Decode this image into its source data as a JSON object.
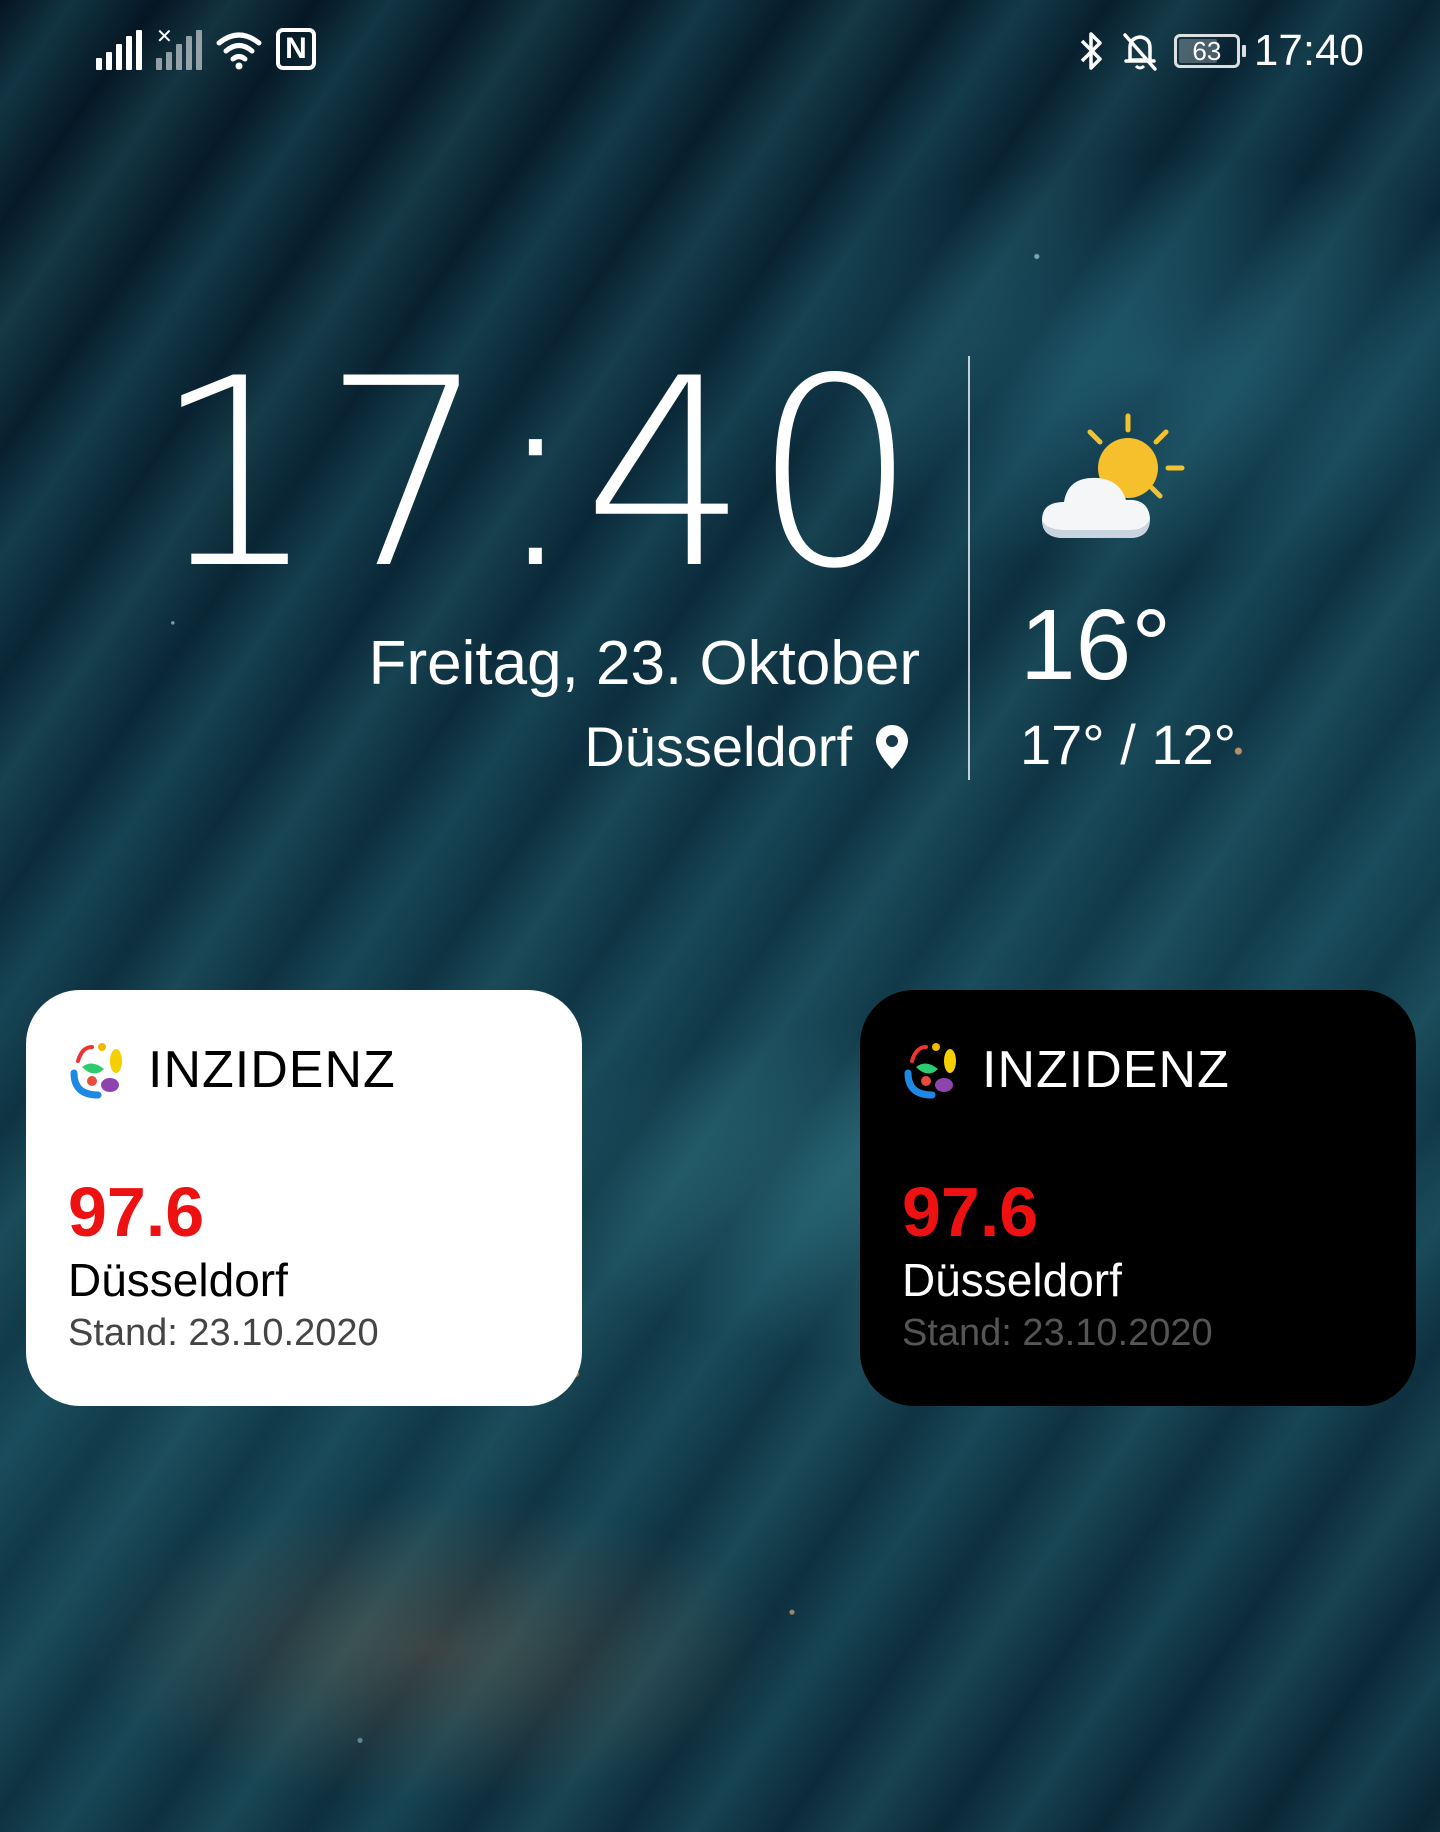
{
  "status_bar": {
    "time": "17:40",
    "battery_level": "63",
    "icons": [
      "signal-icon",
      "signal-no-sim-icon",
      "wifi-icon",
      "nfc-icon",
      "bluetooth-icon",
      "bell-off-icon",
      "battery-icon"
    ]
  },
  "lockscreen": {
    "clock": "17:40",
    "date": "Freitag, 23. Oktober",
    "location": "Düsseldorf",
    "weather": {
      "icon": "partly-cloudy-icon",
      "temperature": "16°",
      "range": "17° / 12°"
    }
  },
  "widgets": [
    {
      "theme": "light",
      "title": "INZIDENZ",
      "value": "97.6",
      "city": "Düsseldorf",
      "stand": "Stand: 23.10.2020"
    },
    {
      "theme": "dark",
      "title": "INZIDENZ",
      "value": "97.6",
      "city": "Düsseldorf",
      "stand": "Stand: 23.10.2020"
    }
  ],
  "colors": {
    "incidence_value": "#ee1111",
    "widget_light_bg": "#ffffff",
    "widget_dark_bg": "#000000"
  }
}
